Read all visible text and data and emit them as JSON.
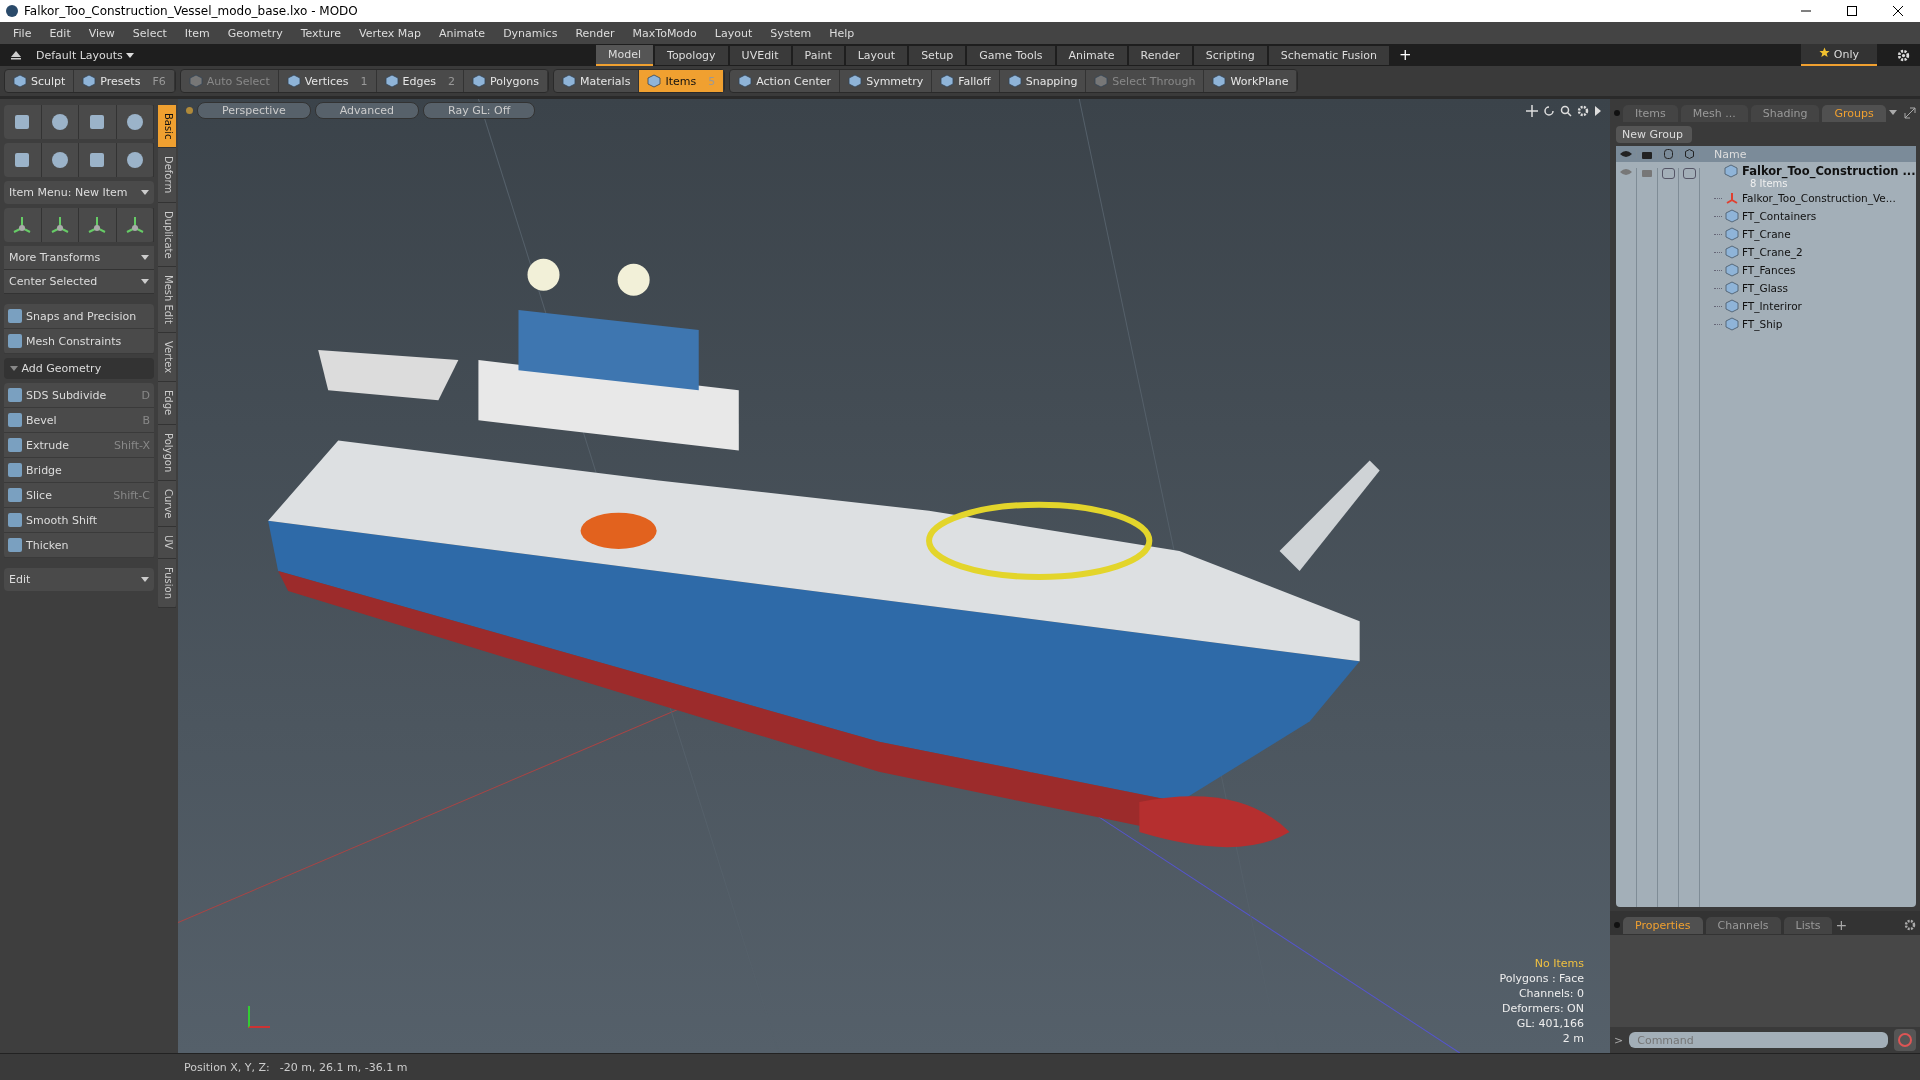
{
  "window": {
    "title": "Falkor_Too_Construction_Vessel_modo_base.lxo - MODO"
  },
  "menu_bar": [
    "File",
    "Edit",
    "View",
    "Select",
    "Item",
    "Geometry",
    "Texture",
    "Vertex Map",
    "Animate",
    "Dynamics",
    "Render",
    "MaxToModo",
    "Layout",
    "System",
    "Help"
  ],
  "layout_bar": {
    "layouts": "Default Layouts",
    "tabs": [
      {
        "label": "Model",
        "selected": true
      },
      {
        "label": "Topology",
        "selected": false
      },
      {
        "label": "UVEdit",
        "selected": false
      },
      {
        "label": "Paint",
        "selected": false
      },
      {
        "label": "Layout",
        "selected": false
      },
      {
        "label": "Setup",
        "selected": false
      },
      {
        "label": "Game Tools",
        "selected": false
      },
      {
        "label": "Animate",
        "selected": false
      },
      {
        "label": "Render",
        "selected": false
      },
      {
        "label": "Scripting",
        "selected": false
      },
      {
        "label": "Schematic Fusion",
        "selected": false
      }
    ],
    "add": "+",
    "only": "Only"
  },
  "toolbar": [
    [
      {
        "label": "Sculpt",
        "selected": false,
        "disabled": false
      },
      {
        "label": "Presets",
        "shortcut": "F6",
        "selected": false,
        "disabled": false
      }
    ],
    [
      {
        "label": "Auto Select",
        "selected": false,
        "disabled": true
      },
      {
        "label": "Vertices",
        "shortcut": "1",
        "selected": false,
        "disabled": false
      },
      {
        "label": "Edges",
        "shortcut": "2",
        "selected": false,
        "disabled": false
      },
      {
        "label": "Polygons",
        "selected": false,
        "disabled": false
      }
    ],
    [
      {
        "label": "Materials",
        "selected": false,
        "disabled": false
      },
      {
        "label": "Items",
        "shortcut": "5",
        "selected": true,
        "disabled": false
      }
    ],
    [
      {
        "label": "Action Center",
        "selected": false,
        "disabled": false
      },
      {
        "label": "Symmetry",
        "selected": false,
        "disabled": false
      },
      {
        "label": "Falloff",
        "selected": false,
        "disabled": false
      },
      {
        "label": "Snapping",
        "selected": false,
        "disabled": false
      },
      {
        "label": "Select Through",
        "selected": false,
        "disabled": true
      },
      {
        "label": "WorkPlane",
        "selected": false,
        "disabled": false
      }
    ]
  ],
  "left_panel": {
    "item_menu": "Item Menu: New Item",
    "transform_menus": [
      "More Transforms",
      "Center Selected"
    ],
    "tools": [
      "Snaps and Precision",
      "Mesh Constraints"
    ],
    "section": "Add Geometry",
    "geometry_tools": [
      {
        "label": "SDS Subdivide",
        "shortcut": "D"
      },
      {
        "label": "Bevel",
        "shortcut": "B"
      },
      {
        "label": "Extrude",
        "shortcut": "Shift-X"
      },
      {
        "label": "Bridge"
      },
      {
        "label": "Slice",
        "shortcut": "Shift-C"
      },
      {
        "label": "Smooth Shift"
      },
      {
        "label": "Thicken"
      }
    ],
    "edit_menu": "Edit",
    "side_tabs": [
      {
        "label": "Basic",
        "selected": true
      },
      {
        "label": "Deform",
        "selected": false
      },
      {
        "label": "Duplicate",
        "selected": false
      },
      {
        "label": "Mesh Edit",
        "selected": false
      },
      {
        "label": "Vertex",
        "selected": false
      },
      {
        "label": "Edge",
        "selected": false
      },
      {
        "label": "Polygon",
        "selected": false
      },
      {
        "label": "Curve",
        "selected": false
      },
      {
        "label": "UV",
        "selected": false
      },
      {
        "label": "Fusion",
        "selected": false
      }
    ]
  },
  "viewport": {
    "buttons": [
      "Perspective",
      "Advanced",
      "Ray GL: Off"
    ],
    "info": [
      {
        "text": "No Items",
        "kind": "highlight"
      },
      {
        "text": "Polygons : Face",
        "kind": "normal"
      },
      {
        "text": "Channels: 0",
        "kind": "normal"
      },
      {
        "text": "Deformers: ON",
        "kind": "normal"
      },
      {
        "text": "GL: 401,166",
        "kind": "normal"
      },
      {
        "text": "2 m",
        "kind": "normal"
      }
    ]
  },
  "right_panel": {
    "tabs": [
      {
        "label": "Items",
        "selected": false
      },
      {
        "label": "Mesh ...",
        "selected": false
      },
      {
        "label": "Shading",
        "selected": false
      },
      {
        "label": "Groups",
        "selected": true
      }
    ],
    "new_group": "New Group",
    "column": "Name",
    "tree": {
      "name": "Falkor_Too_Construction ...",
      "count": "8 Items",
      "locked": false,
      "selectable": false,
      "children": [
        {
          "name": "Falkor_Too_Construction_Ve...",
          "kind": "locator"
        },
        {
          "name": "FT_Containers",
          "kind": "mesh"
        },
        {
          "name": "FT_Crane",
          "kind": "mesh"
        },
        {
          "name": "FT_Crane_2",
          "kind": "mesh"
        },
        {
          "name": "FT_Fances",
          "kind": "mesh"
        },
        {
          "name": "FT_Glass",
          "kind": "mesh"
        },
        {
          "name": "FT_Interiror",
          "kind": "mesh"
        },
        {
          "name": "FT_Ship",
          "kind": "mesh"
        }
      ]
    },
    "bottom_tabs": [
      {
        "label": "Properties",
        "selected": true
      },
      {
        "label": "Channels",
        "selected": false
      },
      {
        "label": "Lists",
        "selected": false
      }
    ],
    "bottom_add": "+",
    "command": {
      "prompt": ">",
      "placeholder": "Command"
    }
  },
  "status_bar": {
    "label": "Position X, Y, Z:",
    "value": "-20 m, 26.1 m, -36.1 m"
  }
}
